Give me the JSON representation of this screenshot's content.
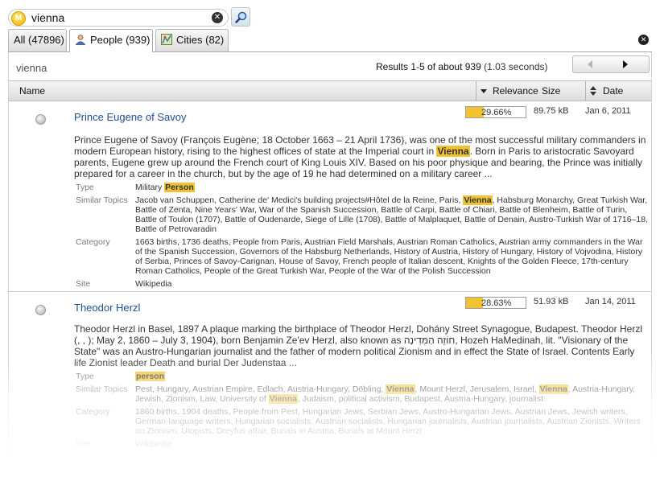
{
  "search": {
    "value": "vienna",
    "clear_icon": "x-circle-icon",
    "search_icon": "magnifier-icon"
  },
  "tabs": [
    {
      "label": "All (47896)",
      "active": false
    },
    {
      "label": "People (939)",
      "active": true,
      "icon": "person-icon"
    },
    {
      "label": "Cities (82)",
      "active": false,
      "icon": "map-icon"
    }
  ],
  "results_header": {
    "query": "vienna",
    "summary": "Results 1-5 of about 939",
    "timing": "(1.03 seconds)"
  },
  "columns": {
    "name": "Name",
    "relevance": "Relevance",
    "size": "Size",
    "date": "Date"
  },
  "colors": {
    "highlight": "#f1c232",
    "link": "#1f4f8f"
  },
  "labels": {
    "type": "Type",
    "similar": "Similar Topics",
    "category": "Category",
    "site": "Site"
  },
  "results": [
    {
      "title": "Prince Eugene of Savoy",
      "relevance": "29.66%",
      "relevance_value": 29.66,
      "size": "89.75 kB",
      "date": "Jan 6, 2011",
      "snippet_a": "Prince Eugene of Savoy (François Eugène; 18 October 1663 – 21 April 1736), was one of the most successful military commanders in modern European history, rising to the highest offices of state at the Imperial court in ",
      "snippet_hl": "Vienna",
      "snippet_b": ". Born in Paris to aristocratic Savoyard parents, Eugene grew up around the French court of King Louis XIV. Based on his poor physique and bearing, the Prince was initially prepared for a career in the church, but by the age of 19 he had determined on a military career ...",
      "type_a": "Military ",
      "type_hl": "Person",
      "similar_a": "Jacob van Schuppen, Catherine de' Medici's building projects#Hôtel de la Reine, Paris, ",
      "similar_hl": "Vienna",
      "similar_b": ", Habsburg Monarchy, Great Turkish War, Battle of Zenta, Nine Years' War, War of the Spanish Succession, Battle of Carpi, Battle of Chiari, Battle of Blenheim, Battle of Turin, Battle of Toulon (1707), Battle of Oudenarde, Siege of Lille (1708), Battle of Malplaquet, Battle of Denain, Austro-Turkish War of 1716–18, Battle of Petrovaradin",
      "category": "1663 births, 1736 deaths, People from Paris, Austrian Field Marshals, Austrian Roman Catholics, Austrian army commanders in the War of the Spanish Succession, Governors of the Habsburg Netherlands, History of Austria, History of Hungary, History of Vojvodina, History of Serbia, Princes of Savoy-Carignan, House of Savoy, French people of Italian descent, Knights of the Golden Fleece, 17th-century Roman Catholics, People of the Great Turkish War, People of the War of the Polish Succession",
      "site": "Wikipedia"
    },
    {
      "title": "Theodor Herzl",
      "relevance": "28.63%",
      "relevance_value": 28.63,
      "size": "51.93 kB",
      "date": "Jan 14, 2011",
      "snippet": "Theodor Herzl in Basel, 1897 A plaque marking the birthplace of Theodor Herzl, Dohány Street Synagogue, Budapest. Theodor Herzl (, , ); May 2, 1860 – July 3, 1904), born Benjamin Ze'ev Herzl, also known as חוֹזֵה הַמְּדִינָה, Hozeh HaMedinah, lit. \"Visionary of the State\" was an Austro-Hungarian journalist and the father of modern political Zionism and in effect the State of Israel. Contents Early life Zionist leader Death and burial Der Judenstaa ...",
      "type_hl": "person",
      "similar_a": "Pest, Hungary, Austrian Empire, Edlach, Austria-Hungary, Döbling, ",
      "similar_hl1": "Vienna",
      "similar_b": ", Mount Herzl, Jerusalem, Israel, ",
      "similar_hl2": "Vienna",
      "similar_c": ", Austria-Hungary, Jewish, Zionism, Law, University of ",
      "similar_hl3": "Vienna",
      "similar_d": ", Judaism, political activism, Budapest, Austria-Hungary, journalist",
      "category": "1860 births, 1904 deaths, People from Pest, Hungarian Jews, Serbian Jews, Austro-Hungarian Jews, Austrian Jews, Jewish writers, German-language writers, Hungarian socialists, Austrian socialists, Hungarian journalists, Austrian journalists, Austrian Zionists, Writers on Zionism, Utopists, Dreyfus affair, Burials in Austria, Burials at Mount Herzl",
      "site": "Wikipedia"
    }
  ]
}
